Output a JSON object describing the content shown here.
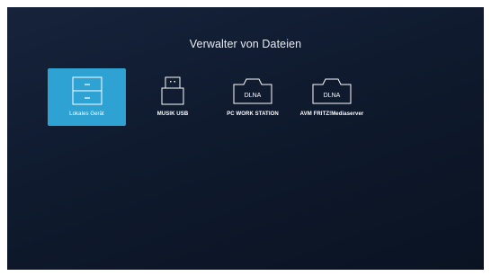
{
  "header": {
    "title": "Verwalter von Dateien"
  },
  "devices": [
    {
      "label": "Lokales Gerät",
      "icon": "drawer-cabinet-icon",
      "selected": true
    },
    {
      "label": "MUSIK USB",
      "icon": "usb-drive-icon",
      "selected": false
    },
    {
      "label": "PC WORK STATION",
      "icon": "dlna-server-icon",
      "badge": "DLNA",
      "selected": false
    },
    {
      "label": "AVM FRITZ!Mediaserver",
      "icon": "dlna-server-icon",
      "badge": "DLNA",
      "selected": false
    }
  ],
  "colors": {
    "background_top": "#16233b",
    "background_bottom": "#0a1322",
    "selected_tile": "#2ea3d3",
    "text": "#ffffff"
  }
}
